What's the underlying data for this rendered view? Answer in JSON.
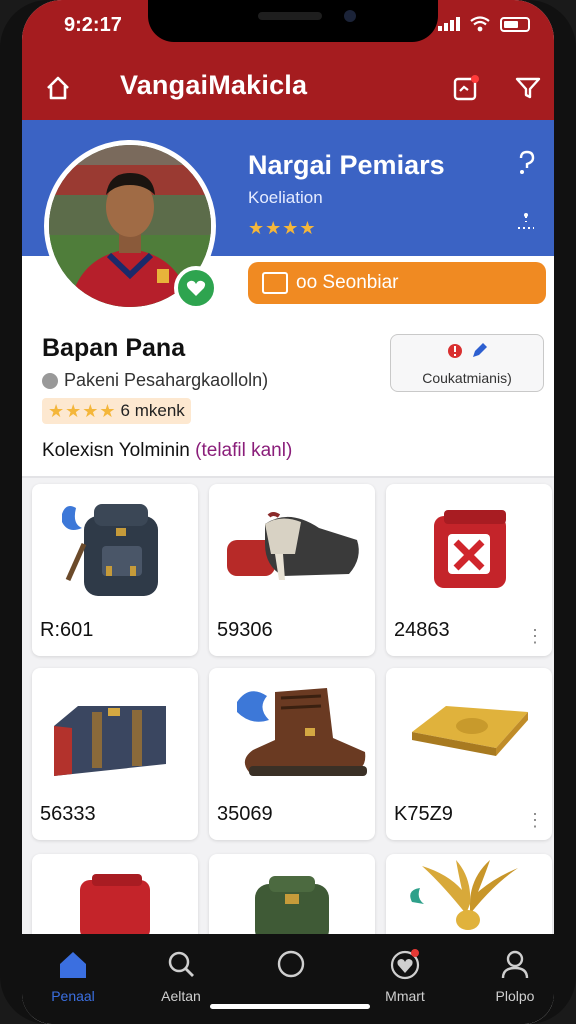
{
  "status_bar": {
    "time": "9:2:17"
  },
  "app_bar": {
    "title": "VangaiMakicla"
  },
  "profile": {
    "header_name": "Nargai Pemiars",
    "header_sub": "Koeliation",
    "header_stars": "★★★★",
    "follow_label": "oo Seonbiar",
    "name": "Bapan Pana",
    "location": "Pakeni Pesahargkaolloln)",
    "rating_stars": "★★★★",
    "rating_text": "6 mkenk",
    "contact_label": "Coukatmianis)",
    "collection_prefix": "Kolexisn Yolminin",
    "collection_accent": "(telafil kanl)"
  },
  "items": [
    {
      "name": "backpack",
      "price": "R:601"
    },
    {
      "name": "cleats",
      "price": "59306"
    },
    {
      "name": "red-box",
      "price": "24863"
    },
    {
      "name": "duffel-bag",
      "price": "56333"
    },
    {
      "name": "boot",
      "price": "35069"
    },
    {
      "name": "gold-tile",
      "price": "K75Z9"
    },
    {
      "name": "red-case",
      "price": ""
    },
    {
      "name": "green-pack",
      "price": ""
    },
    {
      "name": "gold-wings",
      "price": ""
    }
  ],
  "bottom_nav": [
    {
      "label": "Penaal",
      "icon": "home-icon",
      "active": true
    },
    {
      "label": "Aeltan",
      "icon": "search-icon",
      "active": false
    },
    {
      "label": "",
      "icon": "circle-icon",
      "active": false
    },
    {
      "label": "Mmart",
      "icon": "heart-icon",
      "active": false
    },
    {
      "label": "Plolpo",
      "icon": "profile-icon",
      "active": false
    }
  ],
  "colors": {
    "brand_red": "#a51c1f",
    "hero_blue": "#3b63c4",
    "accent_orange": "#f08a22",
    "nav_active": "#3b6fe0"
  }
}
